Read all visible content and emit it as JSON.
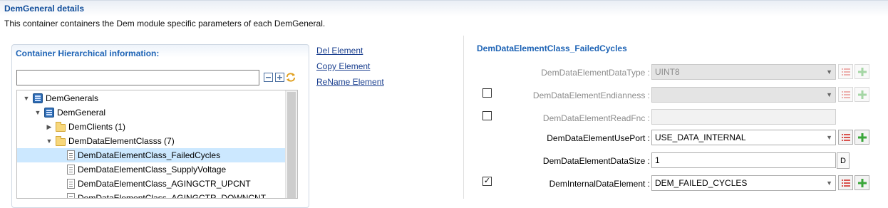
{
  "header": {
    "title": "DemGeneral details",
    "description": "This container containers the Dem module specific parameters of each DemGeneral."
  },
  "hierarchy": {
    "title": "Container Hierarchical information:",
    "filter_value": "",
    "tree": [
      {
        "label": "DemGenerals",
        "icon": "database-icon",
        "twisty": "expanded"
      },
      {
        "label": "DemGeneral",
        "icon": "database-icon",
        "twisty": "expanded"
      },
      {
        "label": "DemClients (1)",
        "icon": "folder-icon",
        "twisty": "collapsed"
      },
      {
        "label": "DemDataElementClasss (7)",
        "icon": "folder-icon",
        "twisty": "expanded"
      },
      {
        "label": "DemDataElementClass_FailedCycles",
        "icon": "document-icon",
        "selected": true
      },
      {
        "label": "DemDataElementClass_SupplyVoltage",
        "icon": "document-icon"
      },
      {
        "label": "DemDataElementClass_AGINGCTR_UPCNT",
        "icon": "document-icon"
      },
      {
        "label": "DemDataElementClass_AGINGCTR_DOWNCNT",
        "icon": "document-icon"
      }
    ]
  },
  "actions": {
    "delete": "Del Element",
    "copy": "Copy Element",
    "rename": "ReName Element"
  },
  "details": {
    "title": "DemDataElementClass_FailedCycles",
    "fields": {
      "data_type": {
        "label": "DemDataElementDataType :",
        "value": "UINT8"
      },
      "endianness": {
        "label": "DemDataElementEndianness :",
        "value": ""
      },
      "read_fnc": {
        "label": "DemDataElementReadFnc :",
        "value": ""
      },
      "use_port": {
        "label": "DemDataElementUsePort :",
        "value": "USE_DATA_INTERNAL"
      },
      "data_size": {
        "label": "DemDataElementDataSize :",
        "value": "1",
        "button": "D"
      },
      "internal_element": {
        "label": "DemInternalDataElement :",
        "value": "DEM_FAILED_CYCLES"
      }
    },
    "checkboxes": {
      "endianness_checked": false,
      "read_fnc_checked": false,
      "internal_element_checked": true
    }
  },
  "colors": {
    "title_blue": "#0f4c9a",
    "selection": "#cce8ff",
    "add_green": "#3aa63a",
    "list_red": "#d9534f"
  }
}
